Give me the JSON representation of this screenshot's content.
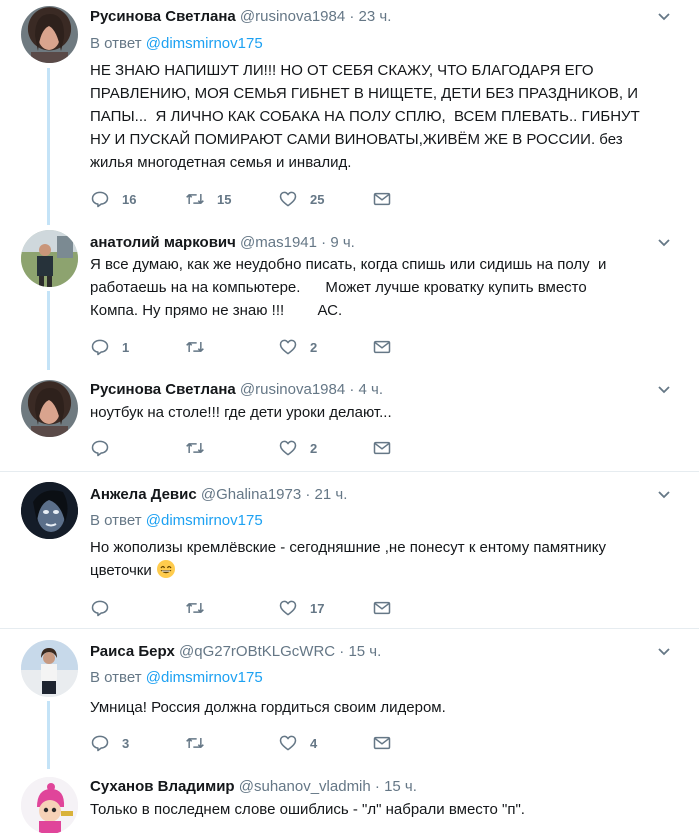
{
  "reply_prefix": "В ответ",
  "tweets": [
    {
      "name": "Русинова Светлана",
      "handle": "@rusinova1984",
      "dot": "·",
      "time": "23 ч.",
      "reply_to": "@dimsmirnov175",
      "text": "НЕ ЗНАЮ НАПИШУТ ЛИ!!! НО ОТ СЕБЯ СКАЖУ, ЧТО БЛАГОДАРЯ ЕГО\nПРАВЛЕНИЮ, МОЯ СЕМЬЯ ГИБНЕТ В НИЩЕТЕ, ДЕТИ БЕЗ ПРАЗДНИКОВ, И\nПАПЫ...  Я ЛИЧНО КАК СОБАКА НА ПОЛУ СПЛЮ,  ВСЕМ ПЛЕВАТЬ.. ГИБНУТ\nНУ И ПУСКАЙ ПОМИРАЮТ САМИ ВИНОВАТЫ,ЖИВЁМ ЖЕ В РОССИИ. без\nжилья многодетная семья и инвалид.",
      "replies": "16",
      "retweets": "15",
      "likes": "25"
    },
    {
      "name": "анатолий маркович",
      "handle": "@mas1941",
      "dot": "·",
      "time": "9 ч.",
      "text": "Я все думаю, как же неудобно писать, когда спишь или сидишь на полу  и\nработаешь на на компьютере.      Может лучше кроватку купить вместо\nКомпа. Ну прямо не знаю !!!        АС.",
      "replies": "1",
      "retweets": "",
      "likes": "2"
    },
    {
      "name": "Русинова Светлана",
      "handle": "@rusinova1984",
      "dot": "·",
      "time": "4 ч.",
      "text": "ноутбук на столе!!! где дети уроки делают...",
      "replies": "",
      "retweets": "",
      "likes": "2"
    },
    {
      "name": "Анжела Девис",
      "handle": "@Ghalina1973",
      "dot": "·",
      "time": "21 ч.",
      "reply_to": "@dimsmirnov175",
      "text": "Но жополизы кремлёвские - сегодняшние ,не понесут к ентому памятнику\nцветочки",
      "emoji": "grinning-emoji",
      "replies": "",
      "retweets": "",
      "likes": "17"
    },
    {
      "name": "Раиса Берх",
      "handle": "@qG27rOBtKLGcWRC",
      "dot": "·",
      "time": "15 ч.",
      "reply_to": "@dimsmirnov175",
      "text": "Умница! Россия должна гордиться своим лидером.",
      "replies": "3",
      "retweets": "",
      "likes": "4"
    },
    {
      "name": "Суханов Владимир",
      "handle": "@suhanov_vladmih",
      "dot": "·",
      "time": "15 ч.",
      "text": "Только в последнем слове ошиблись - \"л\" набрали вместо \"п\".",
      "replies": "",
      "retweets": "",
      "likes": ""
    }
  ],
  "icons": {
    "reply": "reply-icon",
    "retweet": "retweet-icon",
    "like": "heart-icon",
    "dm": "envelope-icon",
    "more": "chevron-down-icon"
  },
  "colors": {
    "link": "#1da1f2",
    "muted": "#657786",
    "thread_line": "#c4e3f7",
    "divider": "#e6ecf0"
  }
}
